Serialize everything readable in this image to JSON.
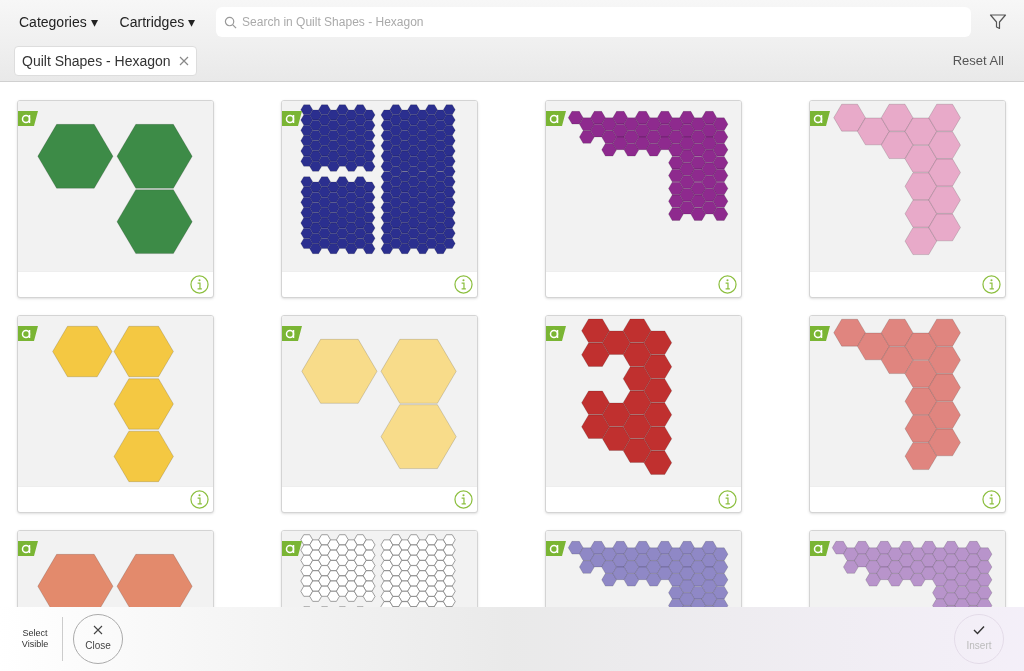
{
  "toolbar": {
    "menus": [
      {
        "label": "Categories ▾"
      },
      {
        "label": "Cartridges ▾"
      }
    ],
    "search": {
      "placeholder": "Search in Quilt Shapes - Hexagon"
    }
  },
  "filter_bar": {
    "chips": [
      {
        "label": "Quilt Shapes - Hexagon"
      }
    ],
    "reset": "Reset All"
  },
  "cards": [
    {
      "color": "#3d8b47",
      "kind": "trio"
    },
    {
      "color": "#2b2f8f",
      "kind": "dense"
    },
    {
      "color": "#8e2a8e",
      "kind": "wide"
    },
    {
      "color": "#e8aac9",
      "kind": "corner"
    },
    {
      "color": "#f4c842",
      "kind": "column"
    },
    {
      "color": "#f8dc8a",
      "kind": "trio"
    },
    {
      "color": "#c0302f",
      "kind": "ring"
    },
    {
      "color": "#e0857f",
      "kind": "corner"
    },
    {
      "color": "#e38a6c",
      "kind": "trio"
    },
    {
      "color": "#ffffff",
      "kind": "dense"
    },
    {
      "color": "#8f88c6",
      "kind": "wide"
    },
    {
      "color": "#b894cb",
      "kind": "wide"
    }
  ],
  "bottom_bar": {
    "select": "Select Visible",
    "close": "Close",
    "insert": {
      "label": "Insert",
      "disabled": true
    }
  }
}
